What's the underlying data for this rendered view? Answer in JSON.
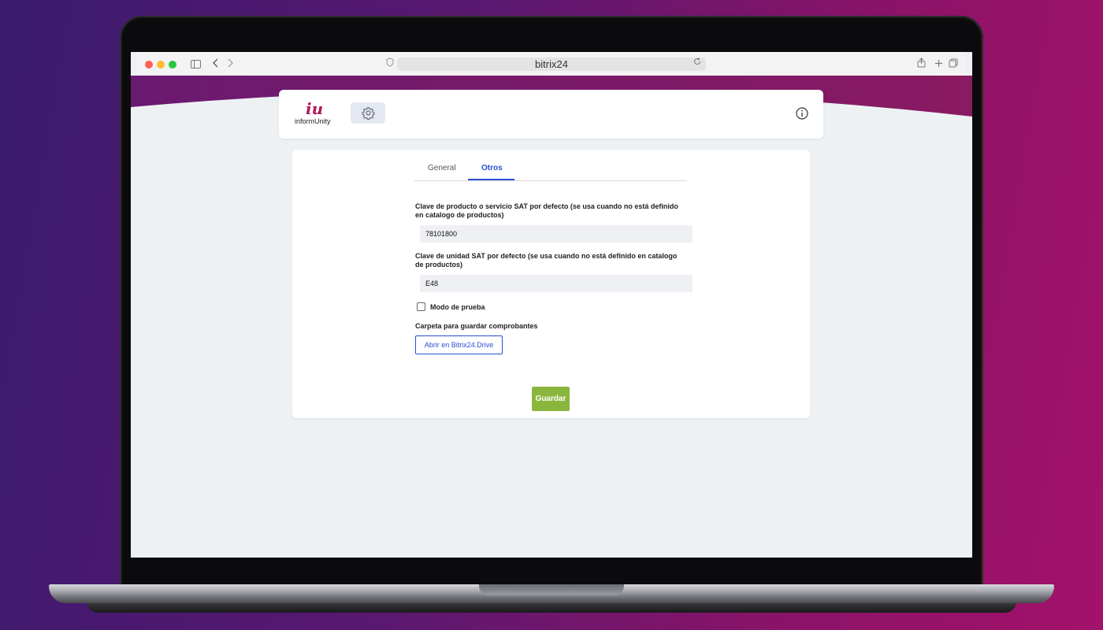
{
  "browser": {
    "url": "bitrix24",
    "traffic_lights": [
      "#ff5f57",
      "#febc2e",
      "#28c840"
    ],
    "icons": [
      "sidebar-icon",
      "back-icon",
      "forward-icon",
      "shield-icon",
      "reload-icon",
      "share-icon",
      "new-tab-icon",
      "tabs-overview-icon"
    ]
  },
  "app": {
    "logo_mark": "iu",
    "logo_text": "informUnity",
    "settings_icon": "gear-icon",
    "info_icon": "info-icon",
    "brand_color": "#b0185a"
  },
  "tabs": [
    {
      "label": "General",
      "active": false
    },
    {
      "label": "Otros",
      "active": true
    }
  ],
  "form": {
    "product_key_label": "Clave de producto o servicio SAT por defecto (se usa cuando no está definido en catalogo de productos)",
    "product_key_value": "78101800",
    "unit_key_label": "Clave de unidad SAT por defecto (se usa cuando no está definido en catalogo de productos)",
    "unit_key_value": "E48",
    "test_mode_label": "Modo de prueba",
    "test_mode_checked": false,
    "folder_label": "Carpeta para guardar comprobantes",
    "drive_button": "Abrir en Bitrix24.Drive",
    "save_button": "Guardar"
  },
  "colors": {
    "accent": "#2a4fd3",
    "save": "#8bb63e"
  }
}
